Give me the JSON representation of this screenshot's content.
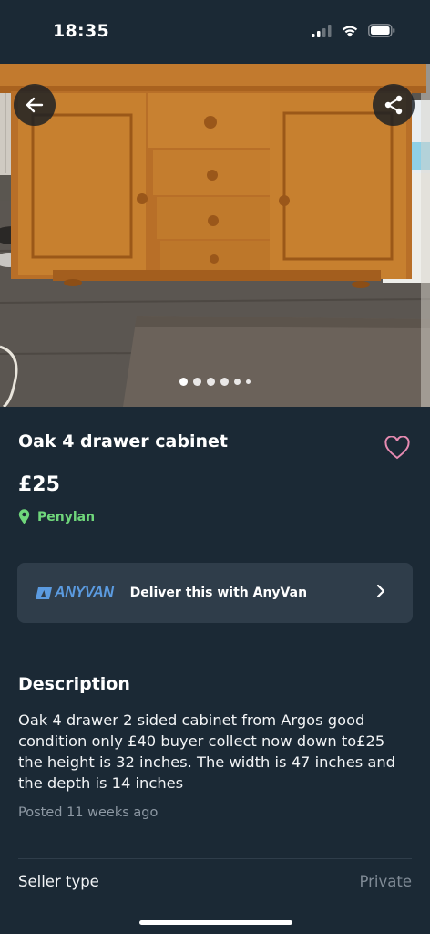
{
  "status_bar": {
    "time": "18:35",
    "icons": [
      "cellular-signal-icon",
      "wifi-icon",
      "battery-icon"
    ]
  },
  "gallery": {
    "image_description_icon": "cabinet-photo",
    "page_count": 6,
    "current_page": 1,
    "back_icon": "arrow-left-icon",
    "share_icon": "share-icon"
  },
  "listing": {
    "title": "Oak 4 drawer cabinet",
    "price": "£25",
    "location": "Penylan",
    "favorited": false
  },
  "delivery": {
    "brand": "ANYVAN",
    "label": "Deliver this with AnyVan"
  },
  "description": {
    "heading": "Description",
    "body": "Oak 4 drawer 2 sided cabinet from Argos good\ncondition only £40 buyer collect  now down to£25\nthe height is 32 inches. The width is 47 inches and\nthe depth is 14 inches",
    "posted": "Posted 11 weeks ago"
  },
  "details": {
    "seller_type_label": "Seller type",
    "seller_type_value": "Private"
  },
  "colors": {
    "background": "#1b2935",
    "card": "#2f3d4a",
    "accent_green": "#6fd67b",
    "heart_pink": "#e68ab1",
    "anyvan_blue": "#5b9be0"
  }
}
